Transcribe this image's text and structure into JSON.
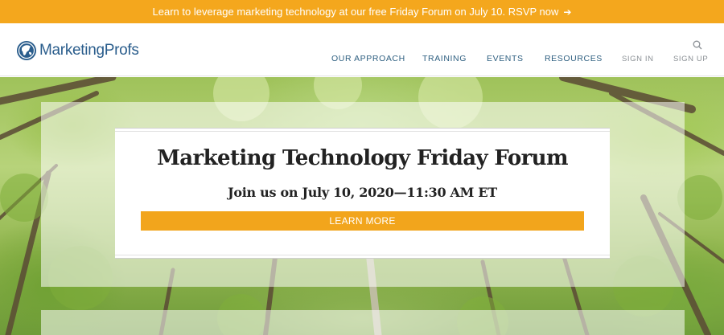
{
  "promo": {
    "text": "Learn to leverage marketing technology at our free Friday Forum on July 10. RSVP now",
    "arrow": "➔"
  },
  "header": {
    "logo_text": "MarketingProfs",
    "search_icon": "search-icon",
    "nav": [
      {
        "label": "OUR APPROACH"
      },
      {
        "label": "TRAINING"
      },
      {
        "label": "EVENTS"
      },
      {
        "label": "RESOURCES"
      }
    ],
    "sign_in": "SIGN IN",
    "sign_up": "SIGN UP"
  },
  "hero": {
    "title": "Marketing Technology Friday Forum",
    "subtitle": "Join us on July 10, 2020—11:30 AM ET",
    "button_label": "LEARN MORE"
  },
  "colors": {
    "accent_orange": "#f4a71d",
    "brand_blue": "#2a5d8c",
    "nav_blue": "#2e5f80"
  }
}
